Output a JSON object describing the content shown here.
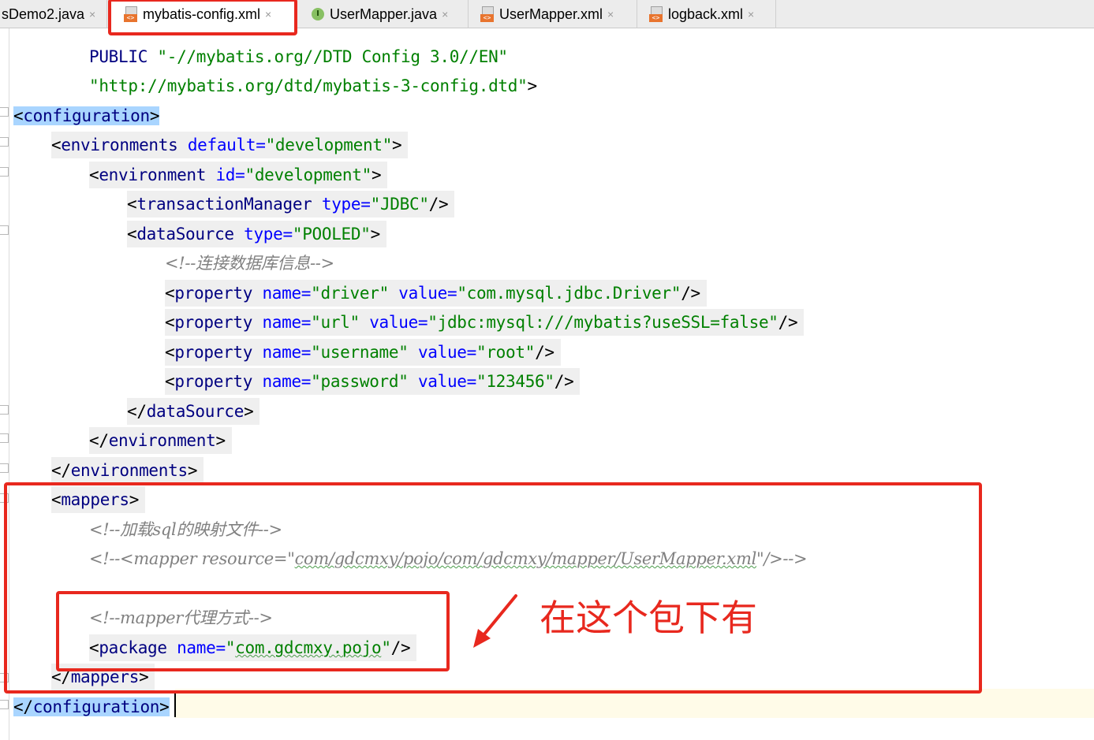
{
  "tabs": [
    {
      "label": "sDemo2.java",
      "type": "java"
    },
    {
      "label": "mybatis-config.xml",
      "type": "xml",
      "active": true
    },
    {
      "label": "UserMapper.java",
      "type": "interface"
    },
    {
      "label": "UserMapper.xml",
      "type": "xml"
    },
    {
      "label": "logback.xml",
      "type": "xml"
    }
  ],
  "close_glyph": "×",
  "code": {
    "public_id": "-//mybatis.org//DTD Config 3.0//EN",
    "system_id": "http://mybatis.org/dtd/mybatis-3-config.dtd",
    "environments_default": "development",
    "environment_id": "development",
    "transaction_type": "JDBC",
    "datasource_type": "POOLED",
    "comment_db": "连接数据库信息",
    "properties": [
      {
        "name": "driver",
        "value": "com.mysql.jdbc.Driver"
      },
      {
        "name": "url",
        "value": "jdbc:mysql:///mybatis?useSSL=false"
      },
      {
        "name": "username",
        "value": "root"
      },
      {
        "name": "password",
        "value": "123456"
      }
    ],
    "comment_load": "加载sql的映射文件",
    "comment_mapper_resource": "com/gdcmxy/pojo/com/gdcmxy/mapper/UserMapper.xml",
    "comment_proxy": "mapper代理方式",
    "package_name": "com.gdcmxy.pojo"
  },
  "annotation_text": "在这个包下有",
  "colors": {
    "tag": "#000080",
    "attribute": "#0000ff",
    "value": "#008000",
    "comment": "#808080",
    "highlight_red": "#e8281e",
    "tag_match": "#a9d5ff"
  }
}
